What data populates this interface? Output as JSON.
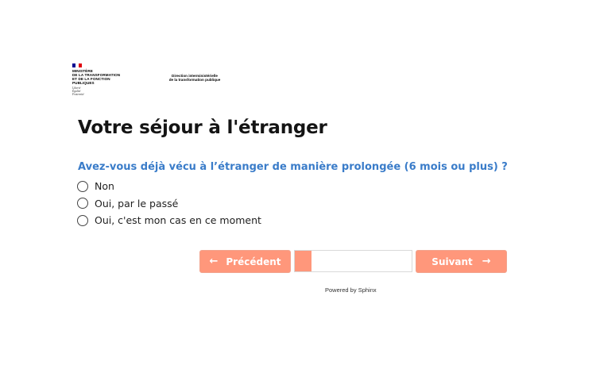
{
  "header": {
    "ministere_lines": [
      "Ministère",
      "de la transformation",
      "et de la fonction",
      "publiques"
    ],
    "devise_lines": [
      "Liberté",
      "Égalité",
      "Fraternité"
    ],
    "ditp_lines": [
      "Direction interministérielle",
      "de la transformation publique"
    ],
    "flag_colors": [
      "#000091",
      "#ffffff",
      "#e1000f"
    ]
  },
  "page": {
    "title": "Votre séjour à l'étranger"
  },
  "question": {
    "text": "Avez-vous déjà vécu à l’étranger de manière prolongée (6 mois ou plus) ?",
    "options": [
      "Non",
      "Oui, par le passé",
      "Oui, c'est mon cas en ce moment"
    ]
  },
  "navigation": {
    "prev_label": "Précédent",
    "next_label": "Suivant",
    "progress_fraction": 0.14,
    "accent_color": "#ff977b"
  },
  "footer": {
    "powered_by": "Powered by Sphinx"
  }
}
